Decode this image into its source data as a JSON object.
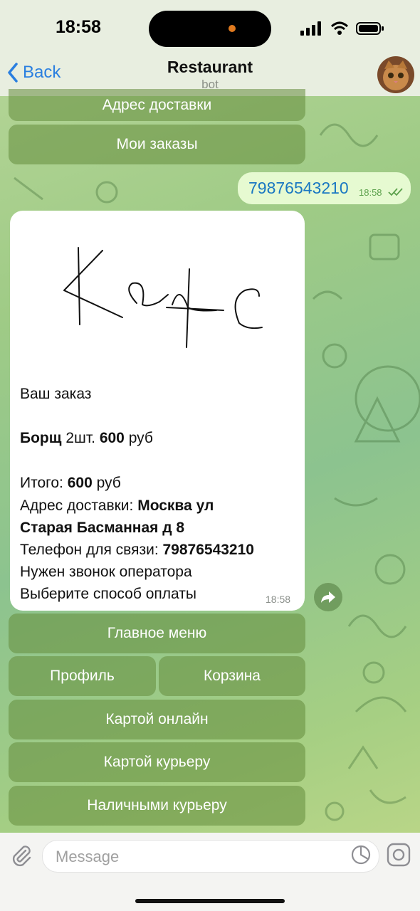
{
  "status_bar": {
    "time": "18:58"
  },
  "header": {
    "back_label": "Back",
    "title": "Restaurant",
    "subtitle": "bot"
  },
  "top_keyboard": {
    "address_label": "Адрес доставки",
    "my_orders_label": "Мои заказы"
  },
  "outgoing": {
    "text": "79876543210",
    "time": "18:58"
  },
  "order_card": {
    "image_caption": "Kafe",
    "header": "Ваш заказ",
    "item_name": "Борщ",
    "item_qty": "2шт.",
    "item_price": "600",
    "currency": "руб",
    "total_label": "Итого:",
    "total_value": "600",
    "address_label": "Адрес доставки:",
    "address_line1": "Москва ул",
    "address_line2": "Старая Басманная д 8",
    "phone_label": "Телефон для связи:",
    "phone_value": "79876543210",
    "operator_note": "Нужен звонок оператора",
    "payment_prompt": "Выберите способ оплаты",
    "time": "18:58"
  },
  "inline_keyboard": {
    "main_menu": "Главное меню",
    "profile": "Профиль",
    "cart": "Корзина",
    "card_online": "Картой онлайн",
    "card_courier": "Картой курьеру",
    "cash_courier": "Наличными курьеру"
  },
  "composer": {
    "placeholder": "Message"
  },
  "icons": [
    "chevron-left-icon",
    "signal-icon",
    "wifi-icon",
    "battery-icon",
    "double-check-icon",
    "share-icon",
    "paperclip-icon",
    "sticker-icon",
    "camera-icon"
  ],
  "colors": {
    "accent": "#2a7fe0",
    "outgoing_bubble": "#e6fad1",
    "outgoing_text": "#1a78c2",
    "button_green": "#7fa85a"
  }
}
